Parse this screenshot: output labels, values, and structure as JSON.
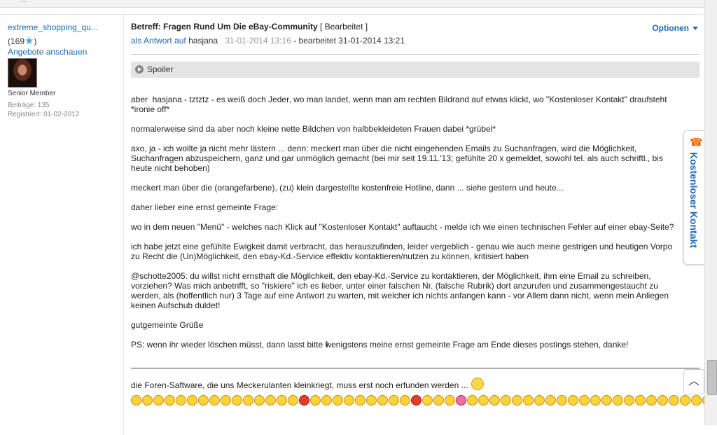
{
  "top_fragment": "...",
  "author": {
    "name": "extreme_shopping_qu...",
    "rating_open": "(169",
    "rating_close": ")",
    "offers_link": "Angebote anschauen",
    "rank": "Senior Member",
    "posts": "Beiträge: 135",
    "registered": "Registriert: 01-02-2012"
  },
  "post": {
    "subject_bold": "Betreff: Fragen Rund Um Die eBay-Community",
    "subject_edited": "[ Bearbeitet ]",
    "reply_link": "als Antwort auf",
    "reply_user": "hasjana",
    "date": "31-01-2014 13:16",
    "edited": "- bearbeitet 31-01-2014 13:21",
    "options": "Optionen",
    "spoiler": "Spoiler",
    "paragraphs": [
      "aber  hasjana - tztztz - es weiß doch Jeder, wo man landet, wenn man am rechten Bildrand auf etwas klickt, wo \"Kostenloser Kontakt\" draufsteht\n*ironie off*",
      "normalerweise sind da aber noch kleine nette Bildchen von halbbekleideten Frauen dabei *grübel*",
      "axo, ja - ich wollte ja nicht mehr lästern ... denn: meckert man über die nicht eingehenden Emails zu Suchanfragen, wird die Möglichkeit,\nSuchanfragen abzuspeichern, ganz und gar unmöglich gemacht (bei mir seit 19.11.'13; gefühlte 20 x gemeldet, sowohl tel. als auch schriftl., bis\nheute nicht behoben)",
      "meckert man über die (orangefarbene), (zu) klein dargestellte kostenfreie Hotline, dann ... siehe gestern und heute...",
      "daher lieber eine ernst gemeinte Frage:",
      "wo in dem neuen \"Menü\" - welches nach Klick auf \"Kostenloser Kontakt\" auftaucht - melde ich wie einen technischen Fehler auf einer ebay-Seite?",
      "ich habe jetzt eine gefühlte Ewigkeit damit verbracht, das herauszufinden, leider vergeblich - genau wie auch meine gestrigen und heutigen Vorpo\nzu Recht die (Un)Möglichkeit, den ebay-Kd.-Service effektiv kontaktieren/nutzen zu können, kritisiert haben",
      "@schotte2005: du willst nicht ernsthaft die Möglichkeit, den ebay-Kd.-Service zu kontaktieren, der Möglichkeit, ihm eine Email zu schreiben,\nvorziehen? Was mich anbetrifft, so \"riskiere\" ich es lieber, unter einer falschen Nr. (falsche Rubrik) dort anzurufen und zusammengestaucht zu\nwerden, als (hoffentlich nur) 3 Tage auf eine Antwort zu warten, mit welcher ich nichts anfangen kann - vor Allem dann nicht, wenn mein Anliegen\nkeinen Aufschub duldet!",
      "gutgemeinte Grüße",
      "PS: wenn ihr wieder löschen müsst, dann lasst bitte wenigstens meine ernst gemeinte Frage am Ende dieses postings stehen, danke!"
    ],
    "signature": "die Foren-Saftware, die uns Meckerulanten kleinkriegt, muss erst noch erfunden werden ..."
  },
  "side_tab": {
    "label": "Kostenloser Kontakt",
    "icon": "phone-icon"
  },
  "scroll_top_icon": "chevron-up-icon",
  "colors": {
    "link": "#1a68b8",
    "accent": "#e8620c",
    "spoiler_bg": "#e4e4e4"
  }
}
